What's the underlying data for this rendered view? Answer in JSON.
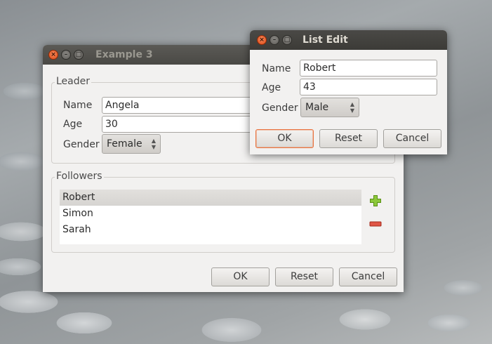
{
  "main_window": {
    "title": "Example 3",
    "leader": {
      "group_title": "Leader",
      "name_label": "Name",
      "name_value": "Angela",
      "age_label": "Age",
      "age_value": "30",
      "gender_label": "Gender",
      "gender_value": "Female"
    },
    "followers": {
      "group_title": "Followers",
      "items": [
        "Robert",
        "Simon",
        "Sarah"
      ],
      "selected_index": 0
    },
    "buttons": {
      "ok": "OK",
      "reset": "Reset",
      "cancel": "Cancel"
    }
  },
  "dialog": {
    "title": "List Edit",
    "name_label": "Name",
    "name_value": "Robert",
    "age_label": "Age",
    "age_value": "43",
    "gender_label": "Gender",
    "gender_value": "Male",
    "buttons": {
      "ok": "OK",
      "reset": "Reset",
      "cancel": "Cancel"
    }
  },
  "icons": {
    "add": "plus-icon",
    "remove": "minus-icon",
    "close": "close-icon",
    "minimize": "minimize-icon",
    "maximize": "maximize-icon"
  },
  "colors": {
    "titlebar": "#3c3b37",
    "close_button": "#df4a16",
    "focus_ring": "#e9733f",
    "add_icon": "#7cb518",
    "remove_icon": "#d23f2f",
    "window_bg": "#f2f1f0"
  }
}
